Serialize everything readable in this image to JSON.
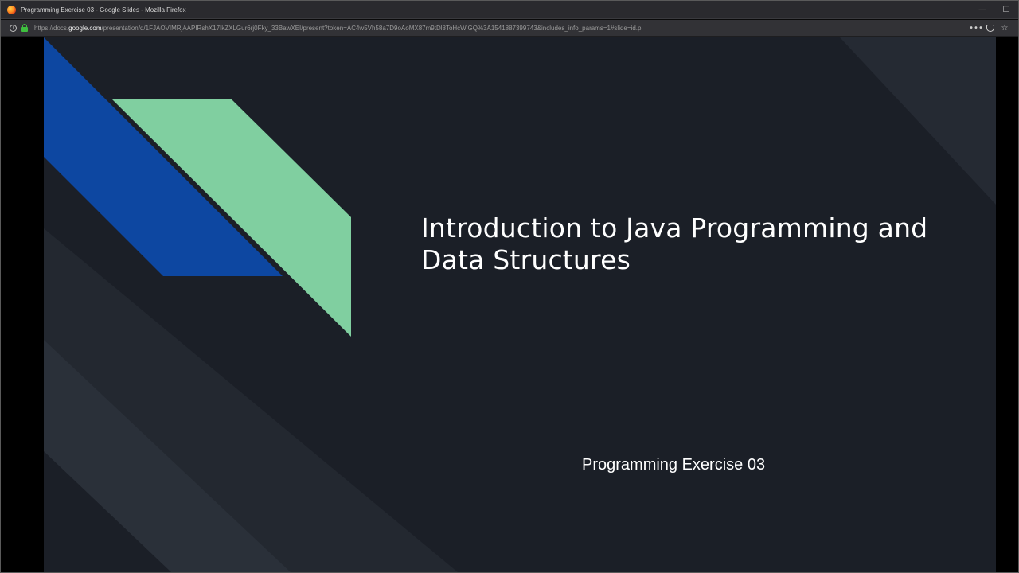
{
  "window": {
    "title": "Programming Exercise 03 - Google Slides - Mozilla Firefox",
    "controls": {
      "minimize": "—",
      "maximize": "☐"
    }
  },
  "urlbar": {
    "prefix": "https://docs.",
    "domain": "google.com",
    "path": "/presentation/d/1FJAOVIMRjAAPIRshX17IkZXLGur6rj0Fky_33BawXEI/present?token=AC4w5Vh58a7D9oAoMX87m9tDl8ToHcWlGQ%3A1541887399743&includes_info_params=1#slide=id.p",
    "actions": {
      "more": "•••",
      "star": "☆"
    }
  },
  "slide": {
    "title": "Introduction to Java Programming and Data Structures",
    "subtitle": "Programming Exercise 03"
  },
  "colors": {
    "slide_background": "#1b1f27",
    "blue_shape": "#0d47a1",
    "green_shape": "#80cfa0",
    "accent_green_lock": "#3fbf3f"
  },
  "icons": {
    "app": "firefox-icon",
    "site_info": "info-icon",
    "secure": "lock-icon",
    "page_actions": "more-icon",
    "pocket": "pocket-icon",
    "bookmark": "star-icon"
  }
}
